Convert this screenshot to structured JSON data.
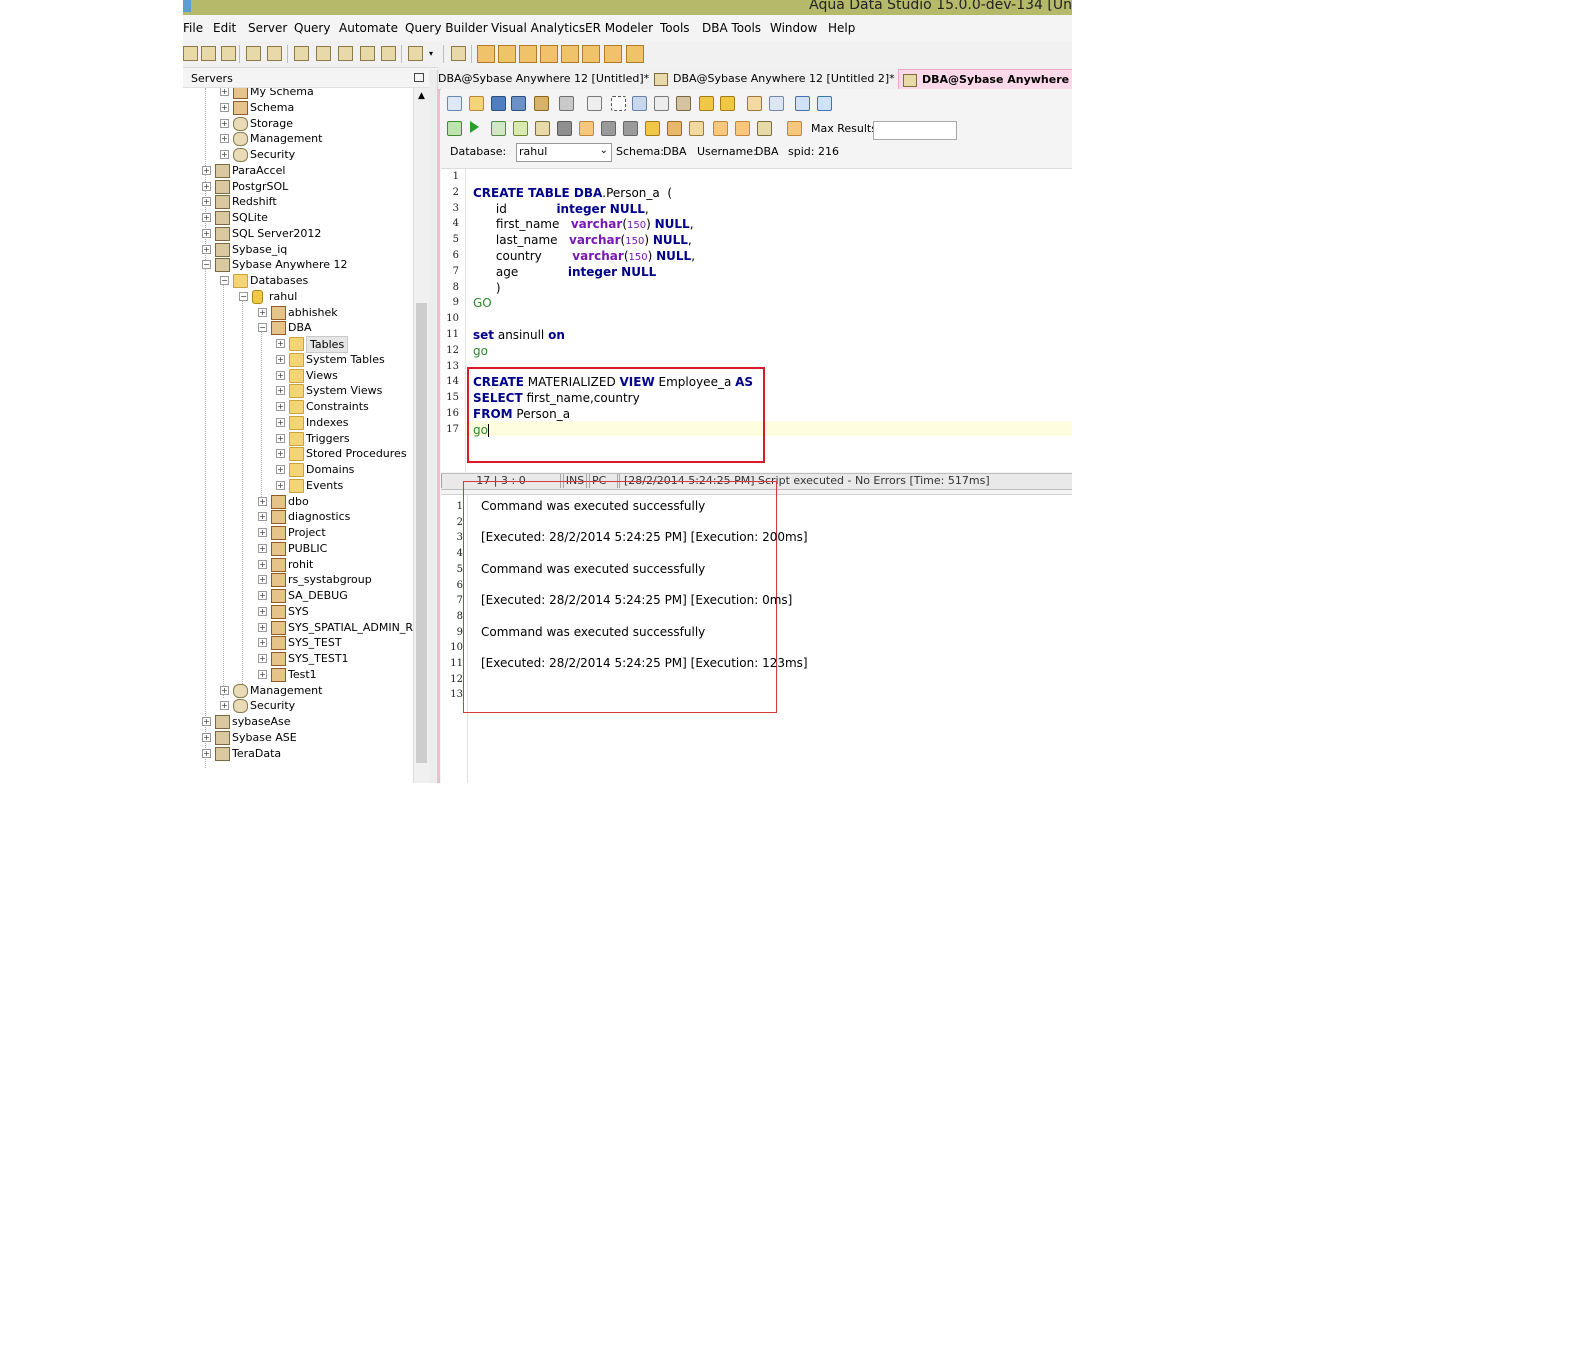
{
  "window": {
    "title": "Aqua Data Studio 15.0.0-dev-134 [Un"
  },
  "menu": [
    "File",
    "Edit",
    "Server",
    "Query",
    "Automate",
    "Query Builder",
    "Visual Analytics",
    "ER Modeler",
    "Tools",
    "DBA Tools",
    "Window",
    "Help"
  ],
  "servers_panel": {
    "title": "Servers"
  },
  "tree": [
    {
      "label": "My Schema",
      "level": 1,
      "icon": "schema"
    },
    {
      "label": "Schema",
      "level": 1,
      "icon": "schema"
    },
    {
      "label": "Storage",
      "level": 1,
      "icon": "gear"
    },
    {
      "label": "Management",
      "level": 1,
      "icon": "gear"
    },
    {
      "label": "Security",
      "level": 1,
      "icon": "gear"
    },
    {
      "label": "ParaAccel",
      "level": 0,
      "icon": "server"
    },
    {
      "label": "PostgrSOL",
      "level": 0,
      "icon": "server"
    },
    {
      "label": "Redshift",
      "level": 0,
      "icon": "server"
    },
    {
      "label": "SQLite",
      "level": 0,
      "icon": "server"
    },
    {
      "label": "SQL Server2012",
      "level": 0,
      "icon": "server"
    },
    {
      "label": "Sybase_iq",
      "level": 0,
      "icon": "server"
    },
    {
      "label": "Sybase Anywhere 12",
      "level": 0,
      "icon": "server",
      "expanded": true
    },
    {
      "label": "Databases",
      "level": 1,
      "icon": "folder",
      "expanded": true
    },
    {
      "label": "rahul",
      "level": 2,
      "icon": "database",
      "expanded": true
    },
    {
      "label": "abhishek",
      "level": 3,
      "icon": "schema"
    },
    {
      "label": "DBA",
      "level": 3,
      "icon": "schema",
      "expanded": true
    },
    {
      "label": "Tables",
      "level": 4,
      "icon": "folder",
      "selected": true
    },
    {
      "label": "System Tables",
      "level": 4,
      "icon": "folder"
    },
    {
      "label": "Views",
      "level": 4,
      "icon": "folder"
    },
    {
      "label": "System Views",
      "level": 4,
      "icon": "folder"
    },
    {
      "label": "Constraints",
      "level": 4,
      "icon": "folder"
    },
    {
      "label": "Indexes",
      "level": 4,
      "icon": "folder"
    },
    {
      "label": "Triggers",
      "level": 4,
      "icon": "folder"
    },
    {
      "label": "Stored Procedures",
      "level": 4,
      "icon": "folder"
    },
    {
      "label": "Domains",
      "level": 4,
      "icon": "folder"
    },
    {
      "label": "Events",
      "level": 4,
      "icon": "folder"
    },
    {
      "label": "dbo",
      "level": 3,
      "icon": "schema"
    },
    {
      "label": "diagnostics",
      "level": 3,
      "icon": "schema"
    },
    {
      "label": "Project",
      "level": 3,
      "icon": "schema"
    },
    {
      "label": "PUBLIC",
      "level": 3,
      "icon": "schema"
    },
    {
      "label": "rohit",
      "level": 3,
      "icon": "schema"
    },
    {
      "label": "rs_systabgroup",
      "level": 3,
      "icon": "schema"
    },
    {
      "label": "SA_DEBUG",
      "level": 3,
      "icon": "schema"
    },
    {
      "label": "SYS",
      "level": 3,
      "icon": "schema"
    },
    {
      "label": "SYS_SPATIAL_ADMIN_RC",
      "level": 3,
      "icon": "schema"
    },
    {
      "label": "SYS_TEST",
      "level": 3,
      "icon": "schema"
    },
    {
      "label": "SYS_TEST1",
      "level": 3,
      "icon": "schema"
    },
    {
      "label": "Test1",
      "level": 3,
      "icon": "schema"
    },
    {
      "label": "Management",
      "level": 1,
      "icon": "gear"
    },
    {
      "label": "Security",
      "level": 1,
      "icon": "gear"
    },
    {
      "label": "sybaseAse",
      "level": 0,
      "icon": "server"
    },
    {
      "label": "Sybase ASE",
      "level": 0,
      "icon": "server"
    },
    {
      "label": "TeraData",
      "level": 0,
      "icon": "server"
    }
  ],
  "tabs": [
    {
      "label": "DBA@Sybase Anywhere 12 [Untitled]*",
      "active": false
    },
    {
      "label": "DBA@Sybase Anywhere 12 [Untitled 2]*",
      "active": false
    },
    {
      "label": "DBA@Sybase Anywhere",
      "active": true
    }
  ],
  "editor_info": {
    "database_label": "Database:",
    "database_value": "rahul",
    "schema_label": "Schema:",
    "schema_value": "DBA",
    "username_label": "Username:",
    "username_value": "DBA",
    "spid_label": "spid:",
    "spid_value": "216",
    "max_results_label": "Max Results:",
    "max_results_value": ""
  },
  "code_lines": [
    {
      "n": "1"
    },
    {
      "n": "2",
      "parts": [
        [
          "kw",
          "CREATE TABLE DBA"
        ],
        [
          "t",
          ".Person_a  ("
        ]
      ]
    },
    {
      "n": "3",
      "parts": [
        [
          "t",
          "      id             "
        ],
        [
          "kw",
          "integer NULL"
        ],
        [
          "t",
          ","
        ]
      ]
    },
    {
      "n": "4",
      "parts": [
        [
          "t",
          "      first_name   "
        ],
        [
          "ty",
          "varchar"
        ],
        [
          "t",
          "("
        ],
        [
          "num",
          "150"
        ],
        [
          "t",
          ") "
        ],
        [
          "kw",
          "NULL"
        ],
        [
          "t",
          ","
        ]
      ]
    },
    {
      "n": "5",
      "parts": [
        [
          "t",
          "      last_name   "
        ],
        [
          "ty",
          "varchar"
        ],
        [
          "t",
          "("
        ],
        [
          "num",
          "150"
        ],
        [
          "t",
          ") "
        ],
        [
          "kw",
          "NULL"
        ],
        [
          "t",
          ","
        ]
      ]
    },
    {
      "n": "6",
      "parts": [
        [
          "t",
          "      country        "
        ],
        [
          "ty",
          "varchar"
        ],
        [
          "t",
          "("
        ],
        [
          "num",
          "150"
        ],
        [
          "t",
          ") "
        ],
        [
          "kw",
          "NULL"
        ],
        [
          "t",
          ","
        ]
      ]
    },
    {
      "n": "7",
      "parts": [
        [
          "t",
          "      age             "
        ],
        [
          "kw",
          "integer NULL"
        ]
      ]
    },
    {
      "n": "8",
      "parts": [
        [
          "t",
          "      )"
        ]
      ]
    },
    {
      "n": "9",
      "parts": [
        [
          "go",
          "GO"
        ]
      ]
    },
    {
      "n": "10"
    },
    {
      "n": "11",
      "parts": [
        [
          "kw",
          "set"
        ],
        [
          "t",
          " ansinull "
        ],
        [
          "kw",
          "on"
        ]
      ]
    },
    {
      "n": "12",
      "parts": [
        [
          "go",
          "go"
        ]
      ]
    },
    {
      "n": "13"
    },
    {
      "n": "14",
      "parts": [
        [
          "kw",
          "CREATE"
        ],
        [
          "t",
          " MATERIALIZED "
        ],
        [
          "kw",
          "VIEW"
        ],
        [
          "t",
          " Employee_a "
        ],
        [
          "kw",
          "AS"
        ]
      ]
    },
    {
      "n": "15",
      "parts": [
        [
          "kw",
          "SELECT"
        ],
        [
          "t",
          " first_name,country"
        ]
      ]
    },
    {
      "n": "16",
      "parts": [
        [
          "kw",
          "FROM"
        ],
        [
          "t",
          " Person_a"
        ]
      ]
    },
    {
      "n": "17",
      "parts": [
        [
          "go",
          "go"
        ]
      ],
      "caret": true
    }
  ],
  "status_bar": {
    "position": "17 | 3 : 0",
    "mode": "INS",
    "encoding": "PC",
    "message": "[28/2/2014 5:24:25 PM] Script executed - No Errors [Time: 517ms]"
  },
  "output_lines": [
    {
      "n": "1",
      "text": "Command was executed successfully"
    },
    {
      "n": "2",
      "text": ""
    },
    {
      "n": "3",
      "text": "[Executed: 28/2/2014 5:24:25 PM] [Execution: 200ms]"
    },
    {
      "n": "4",
      "text": ""
    },
    {
      "n": "5",
      "text": "Command was executed successfully"
    },
    {
      "n": "6",
      "text": ""
    },
    {
      "n": "7",
      "text": "[Executed: 28/2/2014 5:24:25 PM] [Execution: 0ms]"
    },
    {
      "n": "8",
      "text": ""
    },
    {
      "n": "9",
      "text": "Command was executed successfully"
    },
    {
      "n": "10",
      "text": ""
    },
    {
      "n": "11",
      "text": "[Executed: 28/2/2014 5:24:25 PM] [Execution: 123ms]"
    },
    {
      "n": "12",
      "text": ""
    },
    {
      "n": "13",
      "text": ""
    }
  ],
  "colors": {
    "titlebar": "#b5b96a",
    "keyword": "#00008b",
    "type": "#7b16b6",
    "go": "#2a8a2a",
    "highlight_box": "#d81b27",
    "active_tab": "#fbd9e8"
  }
}
